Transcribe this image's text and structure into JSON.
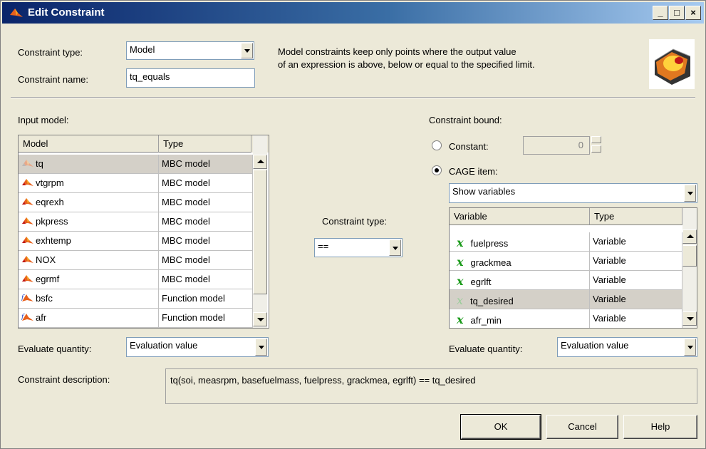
{
  "window": {
    "title": "Edit Constraint",
    "controls": [
      "_",
      "□",
      "×"
    ]
  },
  "header": {
    "type_label": "Constraint type:",
    "type_value": "Model",
    "name_label": "Constraint name:",
    "name_value": "tq_equals",
    "description_line1": "Model constraints keep only points where the output value",
    "description_line2": "of an expression is above, below or equal to the specified limit."
  },
  "input_model": {
    "label": "Input model:",
    "columns": [
      "Model",
      "Type"
    ],
    "rows": [
      {
        "name": "tq",
        "type": "MBC model",
        "icon": "mbc-model-icon-faded"
      },
      {
        "name": "vtgrpm",
        "type": "MBC model",
        "icon": "mbc-model-icon"
      },
      {
        "name": "eqrexh",
        "type": "MBC model",
        "icon": "mbc-model-icon"
      },
      {
        "name": "pkpress",
        "type": "MBC model",
        "icon": "mbc-model-icon"
      },
      {
        "name": "exhtemp",
        "type": "MBC model",
        "icon": "mbc-model-icon"
      },
      {
        "name": "NOX",
        "type": "MBC model",
        "icon": "mbc-model-icon"
      },
      {
        "name": "egrmf",
        "type": "MBC model",
        "icon": "mbc-model-icon"
      },
      {
        "name": "bsfc",
        "type": "Function model",
        "icon": "function-model-icon"
      },
      {
        "name": "afr",
        "type": "Function model",
        "icon": "function-model-icon"
      }
    ],
    "evaluate_label": "Evaluate quantity:",
    "evaluate_value": "Evaluation value"
  },
  "middle": {
    "type_label": "Constraint type:",
    "type_value": "=="
  },
  "bound": {
    "label": "Constraint bound:",
    "constant_label": "Constant:",
    "constant_value": "0",
    "cage_label": "CAGE item:",
    "show_value": "Show variables",
    "columns": [
      "Variable",
      "Type"
    ],
    "rows": [
      {
        "name": "fuelpress",
        "type": "Variable",
        "dim": false
      },
      {
        "name": "grackmea",
        "type": "Variable",
        "dim": false
      },
      {
        "name": "egrlft",
        "type": "Variable",
        "dim": false
      },
      {
        "name": "tq_desired",
        "type": "Variable",
        "dim": true
      },
      {
        "name": "afr_min",
        "type": "Variable",
        "dim": false
      }
    ],
    "evaluate_label": "Evaluate quantity:",
    "evaluate_value": "Evaluation value"
  },
  "description": {
    "label": "Constraint description:",
    "text": "tq(soi, measrpm, basefuelmass, fuelpress, grackmea, egrlft) == tq_desired"
  },
  "buttons": {
    "ok": "OK",
    "cancel": "Cancel",
    "help": "Help"
  }
}
